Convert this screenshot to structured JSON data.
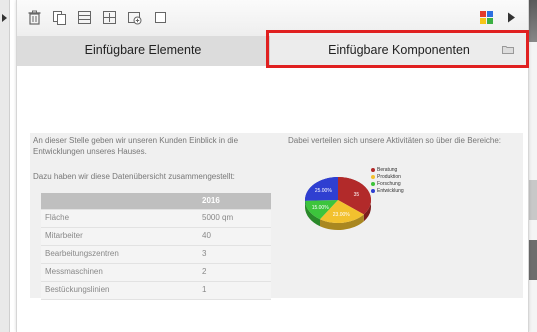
{
  "tabs": [
    {
      "label": "Einfügbare Elemente"
    },
    {
      "label": "Einfügbare Komponenten"
    }
  ],
  "toolbar_icons": [
    "trash-icon",
    "copy-icon",
    "layout-icon",
    "insert-row-icon",
    "gear-add-icon",
    "checkbox-icon",
    "color-grid-icon",
    "play-arrow-icon"
  ],
  "content": {
    "intro": "An dieser Stelle geben wir unseren Kunden Einblick in die Entwicklungen unseres Hauses.",
    "summary": "Dazu haben wir diese Datenübersicht zusammengestellt:",
    "pie_intro": "Dabei verteilen sich unsere Aktivitäten so über die Bereiche:",
    "table": {
      "year": "2016",
      "rows": [
        {
          "label": "Fläche",
          "value": "5000 qm"
        },
        {
          "label": "Mitarbeiter",
          "value": "40"
        },
        {
          "label": "Bearbeitungszentren",
          "value": "3"
        },
        {
          "label": "Messmaschinen",
          "value": "2"
        },
        {
          "label": "Bestückungslinien",
          "value": "1"
        }
      ]
    },
    "pie": {
      "slices": [
        {
          "label": "Beratung",
          "percent": 35,
          "text": "35",
          "color": "#b22a2a"
        },
        {
          "label": "Produktion",
          "percent": 23,
          "text": "23.00%",
          "color": "#f2c12e"
        },
        {
          "label": "Forschung",
          "percent": 15,
          "text": "15.00%",
          "color": "#3cc43c"
        },
        {
          "label": "Entwicklung",
          "percent": 25,
          "text": "25.00%",
          "color": "#2f3fd1"
        }
      ]
    }
  },
  "colors": {
    "highlight": "#e02020"
  }
}
